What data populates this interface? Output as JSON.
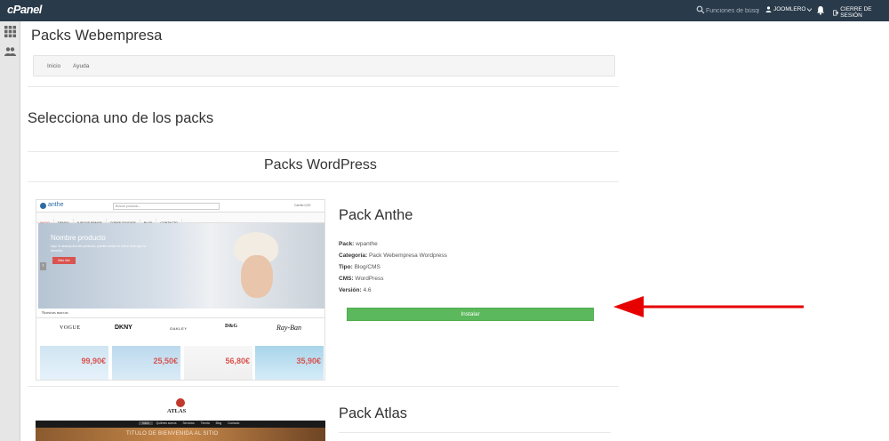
{
  "topbar": {
    "logo": "cPanel",
    "search_placeholder": "Funciones de búsqueda",
    "user": "JOOMLERO",
    "logout": "CIERRE DE SESIÓN"
  },
  "page_title": "Packs Webempresa",
  "breadcrumb": [
    "Inicio",
    "Ayuda"
  ],
  "section_title": "Selecciona uno de los packs",
  "group_title": "Packs WordPress",
  "packs": [
    {
      "title": "Pack Anthe",
      "meta": [
        {
          "label": "Pack:",
          "value": "wpanthe"
        },
        {
          "label": "Categoría:",
          "value": "Pack Webempresa Wordpress"
        },
        {
          "label": "Tipo:",
          "value": "Blog/CMS"
        },
        {
          "label": "CMS:",
          "value": "WordPress"
        },
        {
          "label": "Versión:",
          "value": "4.6"
        }
      ],
      "install_label": "Instalar",
      "thumbnail": {
        "brand": "anthe",
        "search": "Buscar producto...",
        "cart": "Carrito 0,00",
        "menu": [
          "INICIO",
          "TIENDA",
          "JUEGOS ERMOS",
          "CORSE STUDIOS",
          "BLOG",
          "CONTACTO"
        ],
        "hero_title": "Nombre producto",
        "hero_text": "Aquí la descripción del producto, puedes incluir un breve texto que lo describa.",
        "hero_button": "Más info",
        "brands_label": "Nuestras marcas",
        "brands": [
          "VOGUE",
          "DKNY",
          "OAKLEY",
          "D&G",
          "Ray-Ban"
        ],
        "prices": [
          "99,90€",
          "25,50€",
          "56,80€",
          "35,90€"
        ]
      }
    },
    {
      "title": "Pack Atlas",
      "thumbnail": {
        "brand": "ATLAS",
        "menu": [
          "Inicio",
          "Quiénes somos",
          "Servicios",
          "Tienda",
          "Blog",
          "Contacto"
        ],
        "hero_title": "TITULO DE BIENVENIDA AL SITIO"
      }
    }
  ]
}
